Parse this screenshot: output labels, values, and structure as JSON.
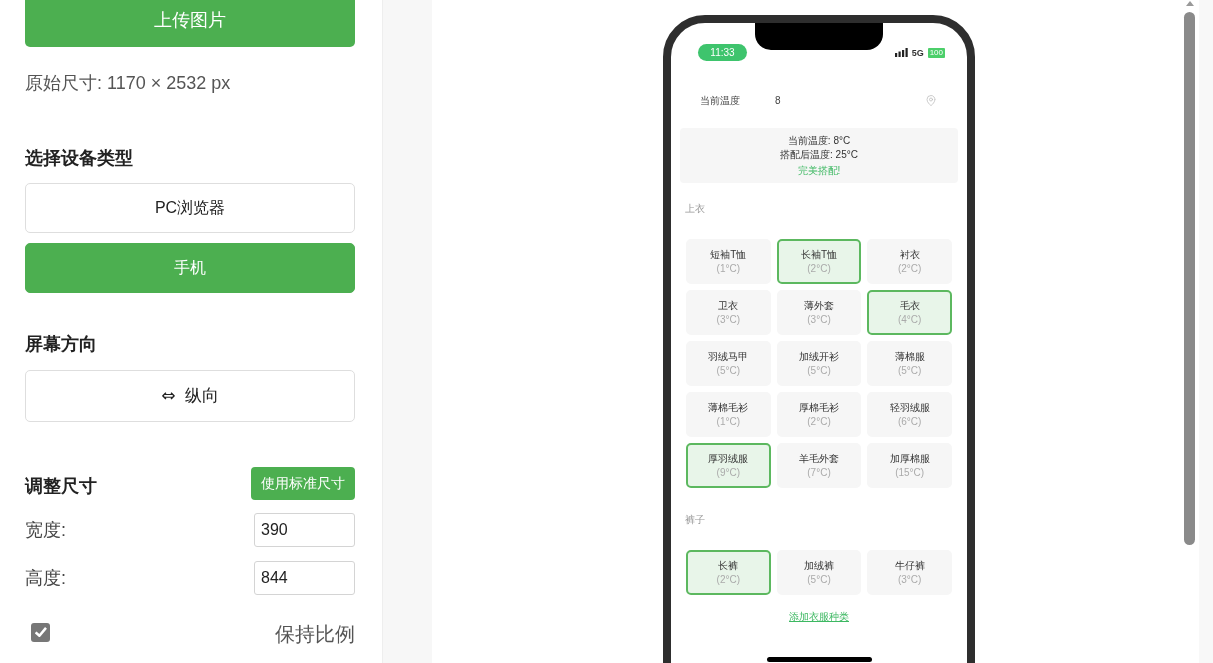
{
  "sidebar": {
    "upload_button": "上传图片",
    "original_size": "原始尺寸: 1170 × 2532 px",
    "device_section": {
      "title": "选择设备类型",
      "options": [
        {
          "label": "PC浏览器",
          "selected": false
        },
        {
          "label": "手机",
          "selected": true
        }
      ]
    },
    "orientation_section": {
      "title": "屏幕方向",
      "button": "⇔ 纵向"
    },
    "size_section": {
      "title": "调整尺寸",
      "standard_button": "使用标准尺寸",
      "fields": [
        {
          "label": "宽度:",
          "value": "390"
        },
        {
          "label": "高度:",
          "value": "844"
        }
      ],
      "keep_ratio": {
        "label": "保持比例",
        "checked": true
      }
    }
  },
  "phone_preview": {
    "status_bar": {
      "time": "11:33",
      "network": "5G",
      "battery": "100"
    },
    "temperature_row": {
      "label": "当前温度",
      "value": "8"
    },
    "summary": {
      "current": "当前温度: 8°C",
      "after": "搭配后温度: 25°C",
      "verdict": "完美搭配!"
    },
    "categories": [
      {
        "title": "上衣",
        "items": [
          {
            "name": "短袖T恤",
            "temp": "(1°C)",
            "selected": false
          },
          {
            "name": "长袖T恤",
            "temp": "(2°C)",
            "selected": true
          },
          {
            "name": "衬衣",
            "temp": "(2°C)",
            "selected": false
          },
          {
            "name": "卫衣",
            "temp": "(3°C)",
            "selected": false
          },
          {
            "name": "薄外套",
            "temp": "(3°C)",
            "selected": false
          },
          {
            "name": "毛衣",
            "temp": "(4°C)",
            "selected": true
          },
          {
            "name": "羽绒马甲",
            "temp": "(5°C)",
            "selected": false
          },
          {
            "name": "加绒开衫",
            "temp": "(5°C)",
            "selected": false
          },
          {
            "name": "薄棉服",
            "temp": "(5°C)",
            "selected": false
          },
          {
            "name": "薄棉毛衫",
            "temp": "(1°C)",
            "selected": false
          },
          {
            "name": "厚棉毛衫",
            "temp": "(2°C)",
            "selected": false
          },
          {
            "name": "轻羽绒服",
            "temp": "(6°C)",
            "selected": false
          },
          {
            "name": "厚羽绒服",
            "temp": "(9°C)",
            "selected": true
          },
          {
            "name": "羊毛外套",
            "temp": "(7°C)",
            "selected": false
          },
          {
            "name": "加厚棉服",
            "temp": "(15°C)",
            "selected": false
          }
        ]
      },
      {
        "title": "裤子",
        "items": [
          {
            "name": "长裤",
            "temp": "(2°C)",
            "selected": true
          },
          {
            "name": "加绒裤",
            "temp": "(5°C)",
            "selected": false
          },
          {
            "name": "牛仔裤",
            "temp": "(3°C)",
            "selected": false
          }
        ]
      }
    ],
    "add_link": "添加衣服种类"
  }
}
